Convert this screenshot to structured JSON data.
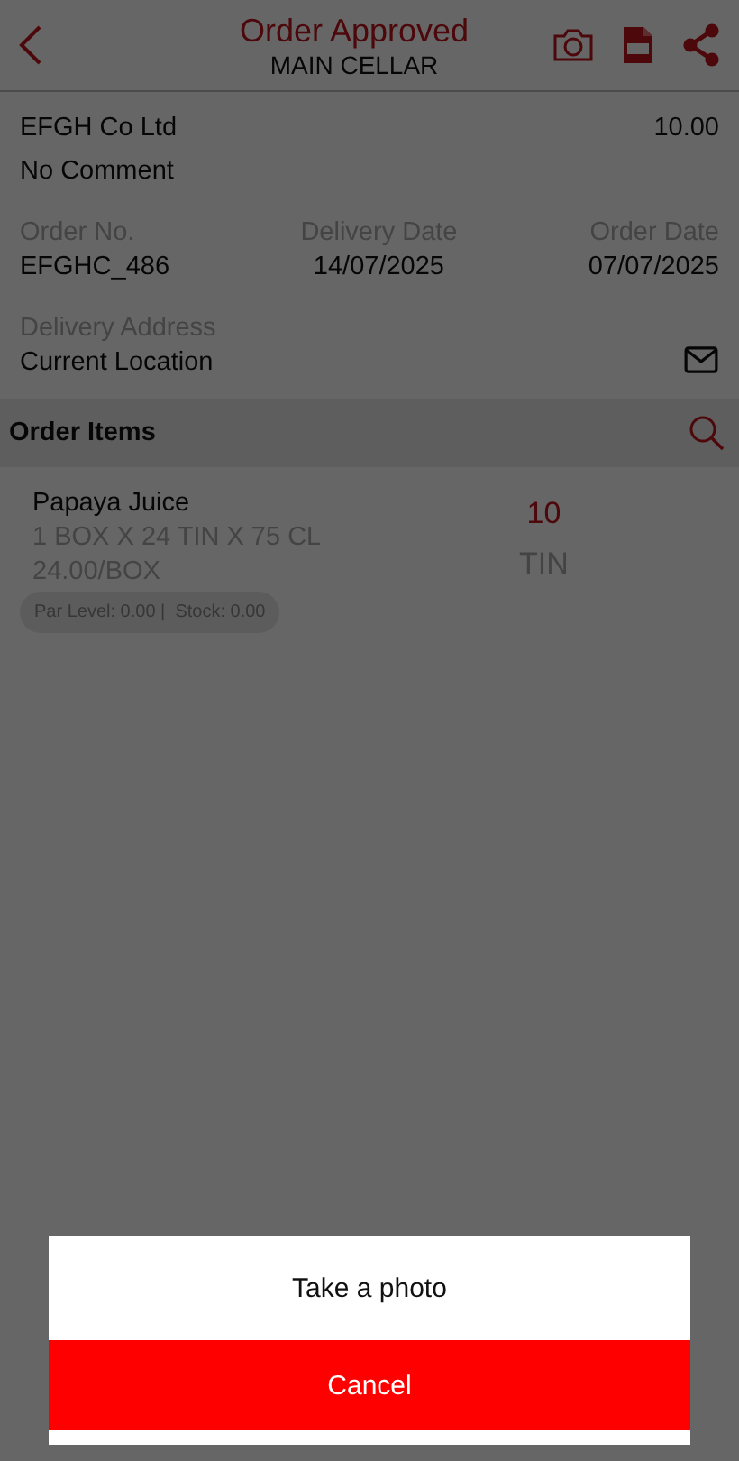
{
  "header": {
    "title": "Order Approved",
    "subtitle": "MAIN CELLAR"
  },
  "order": {
    "supplier": "EFGH Co Ltd",
    "total": "10.00",
    "comment": "No Comment",
    "fields": [
      {
        "label": "Order No.",
        "value": "EFGHC_486"
      },
      {
        "label": "Delivery Date",
        "value": "14/07/2025"
      },
      {
        "label": "Order Date",
        "value": "07/07/2025"
      }
    ],
    "address_label": "Delivery Address",
    "address": "Current Location"
  },
  "items_section": {
    "title": "Order Items"
  },
  "items": [
    {
      "name": "Papaya Juice",
      "pack": "1 BOX X 24 TIN X 75 CL",
      "price": "24.00/BOX",
      "stock_info": "Par Level: 0.00 |  Stock: 0.00",
      "quantity": "10",
      "unit": "TIN"
    }
  ],
  "action_sheet": {
    "options": [
      {
        "label": "Take a photo",
        "kind": "normal"
      },
      {
        "label": "Cancel",
        "kind": "cancel"
      }
    ]
  }
}
